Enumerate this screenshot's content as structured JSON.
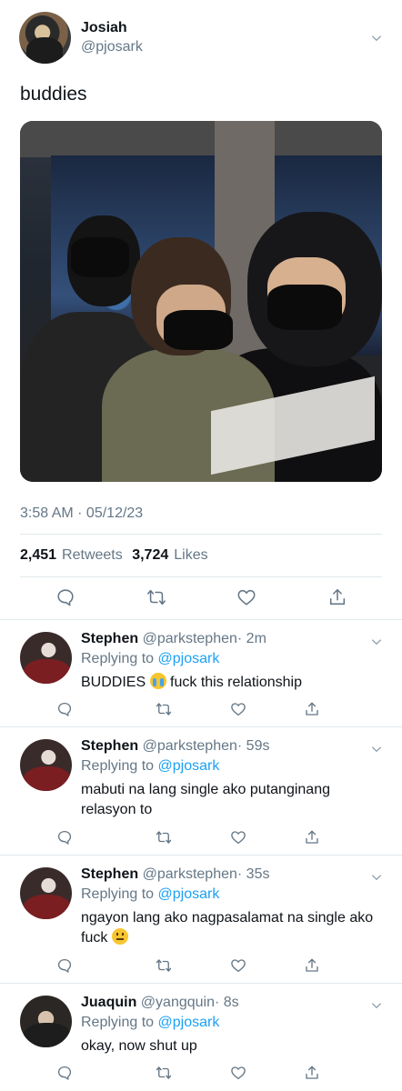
{
  "tweet": {
    "author_name": "Josiah",
    "author_handle": "@pjosark",
    "text": "buddies",
    "timestamp": "3:58 AM · 05/12/23",
    "retweets_count": "2,451",
    "retweets_label": "Retweets",
    "likes_count": "3,724",
    "likes_label": "Likes"
  },
  "colors": {
    "text": "#0f1419",
    "secondary": "#657786",
    "link": "#1da1f2",
    "divider": "#e1e8ed"
  },
  "icons": [
    "reply-icon",
    "retweet-icon",
    "like-icon",
    "share-icon",
    "chevron-down-icon"
  ],
  "replies": [
    {
      "name": "Stephen",
      "handle": "@parkstephen",
      "time": "· 2m",
      "replying_prefix": "Replying to",
      "replying_to": "@pjosark",
      "text_before_emoji": "BUDDIES ",
      "emoji": "loudly-crying-face",
      "text_after_emoji": " fuck this relationship"
    },
    {
      "name": "Stephen",
      "handle": "@parkstephen",
      "time": "· 59s",
      "replying_prefix": "Replying to",
      "replying_to": "@pjosark",
      "text": "mabuti na lang single ako putanginang relasyon to"
    },
    {
      "name": "Stephen",
      "handle": "@parkstephen",
      "time": "· 35s",
      "replying_prefix": "Replying to",
      "replying_to": "@pjosark",
      "text_before_emoji": "ngayon lang ako nagpasalamat na single ako fuck ",
      "emoji": "neutral-face"
    },
    {
      "name": "Juaquin",
      "handle": "@yangquin",
      "time": "· 8s",
      "replying_prefix": "Replying to",
      "replying_to": "@pjosark",
      "text": "okay, now shut up"
    }
  ]
}
